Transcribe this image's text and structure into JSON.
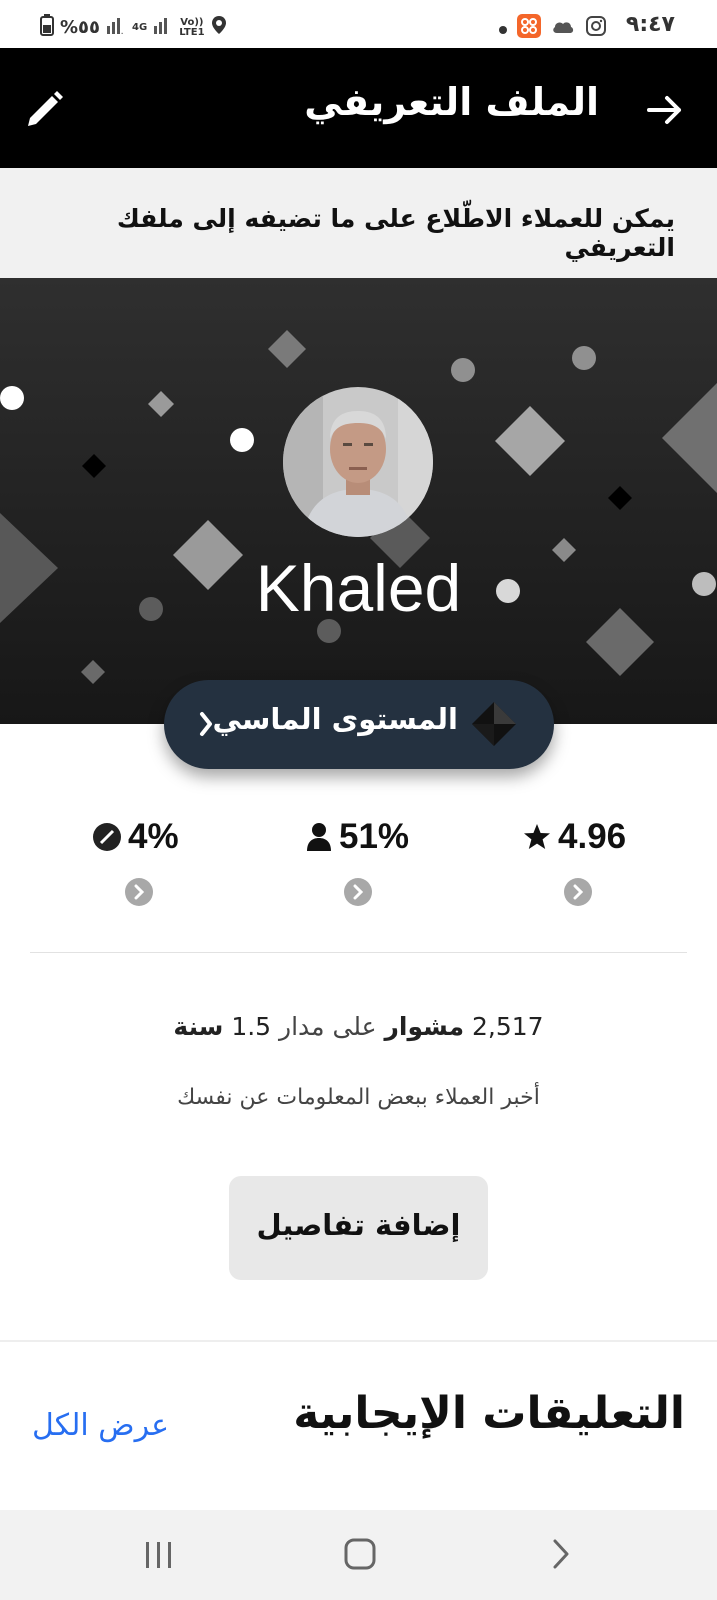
{
  "status_bar": {
    "time": "٩:٤٧",
    "battery": "%٥٥",
    "network_4g": "4G",
    "volte": "Vo))",
    "lte": "LTE1"
  },
  "header": {
    "title": "الملف التعريفي"
  },
  "notice": {
    "text": "يمكن للعملاء الاطّلاع على ما تضيفه إلى ملفك التعريفي"
  },
  "profile": {
    "name": "Khaled"
  },
  "level": {
    "label": "المستوى الماسي"
  },
  "stats": {
    "rating": "4.96",
    "acceptance": "51%",
    "cancellation": "4%"
  },
  "trips": {
    "count": "2,517",
    "unit": "مشوار",
    "over": "على مدار",
    "duration": "1.5",
    "duration_unit": "سنة"
  },
  "about": {
    "prompt": "أخبر العملاء ببعض المعلومات عن نفسك"
  },
  "buttons": {
    "add_details": "إضافة تفاصيل"
  },
  "reviews": {
    "title": "التعليقات الإيجابية",
    "view_all": "عرض الكل"
  },
  "colors": {
    "header_bg": "#000000",
    "pill_bg": "#243140",
    "link": "#276ef1"
  }
}
